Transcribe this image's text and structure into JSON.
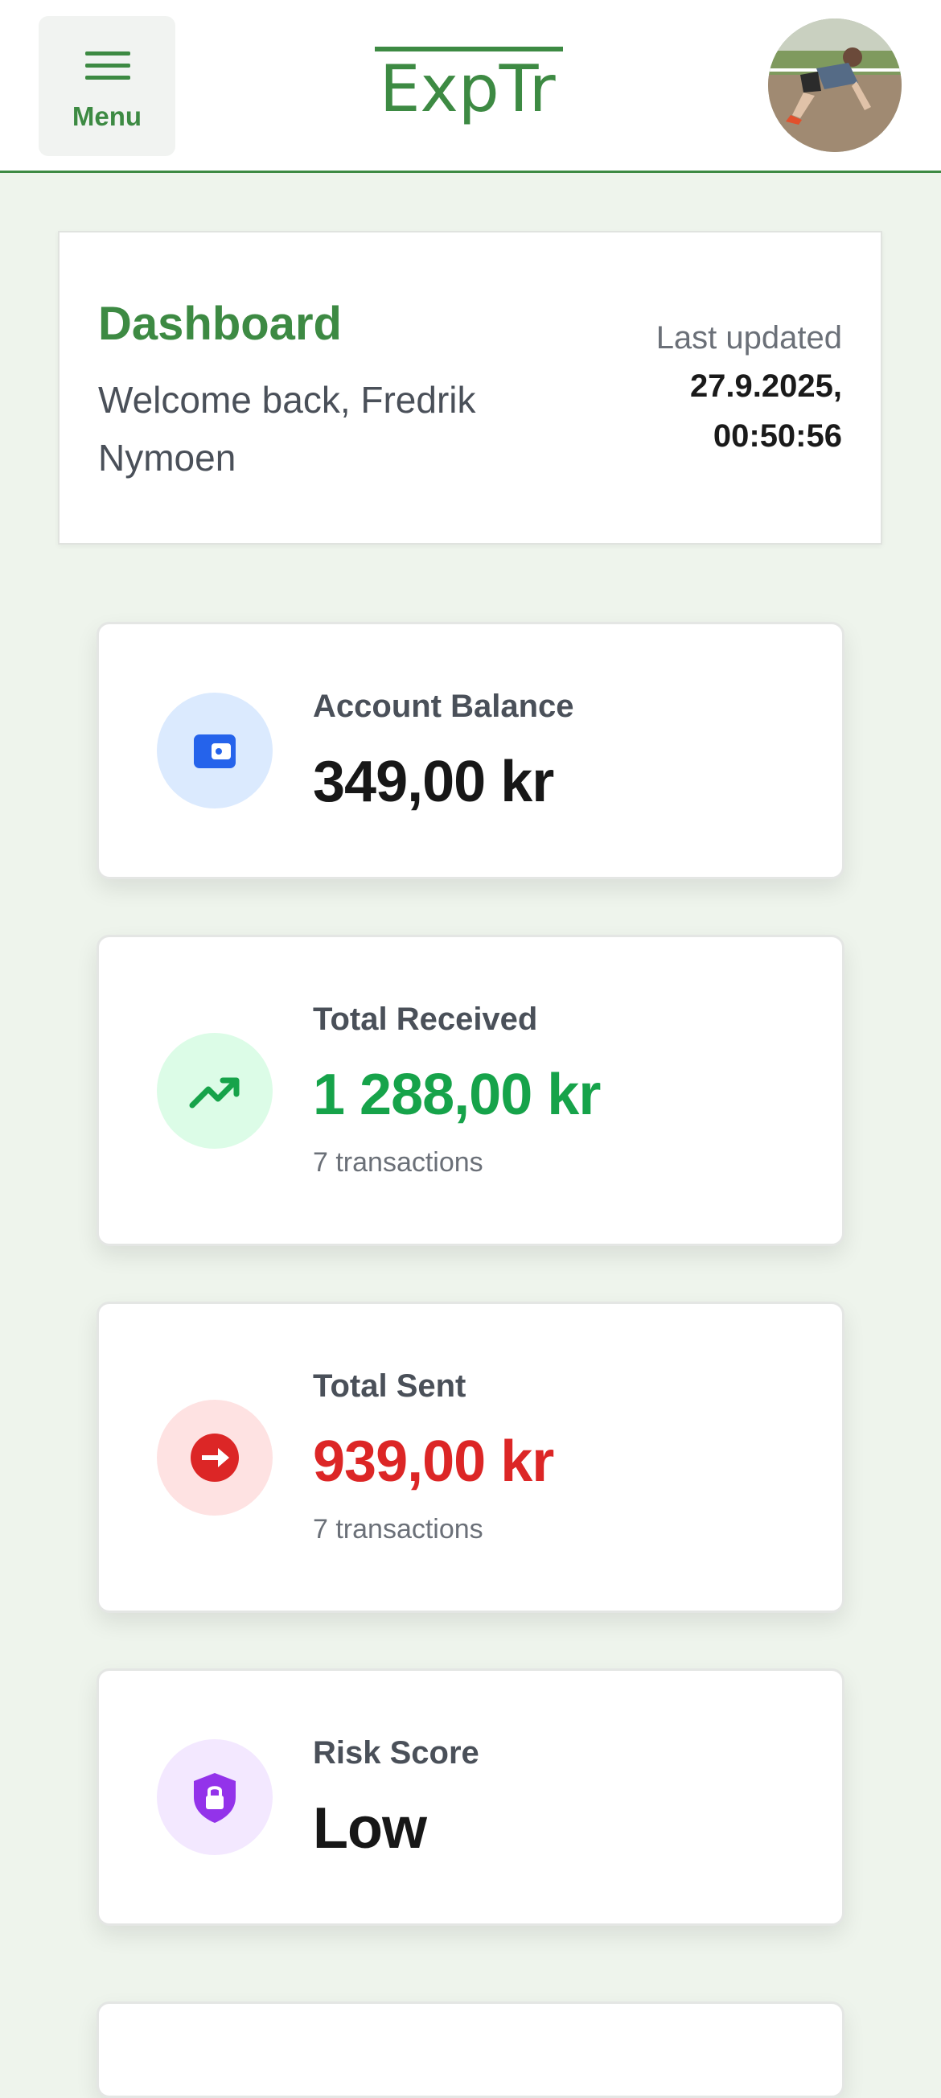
{
  "header": {
    "menu_label": "Menu",
    "logo_text": "ExpTr",
    "avatar_icon": "user-avatar-photo"
  },
  "dashboard": {
    "title": "Dashboard",
    "welcome": "Welcome back, Fredrik Nymoen",
    "last_updated_label": "Last updated",
    "last_updated_value": "27.9.2025, 00:50:56"
  },
  "stats": [
    {
      "label": "Account Balance",
      "value": "349,00 kr",
      "icon": "wallet-icon",
      "icon_bg": "#dbeafe",
      "icon_color": "#2563eb"
    },
    {
      "label": "Total Received",
      "value": "1 288,00 kr",
      "sub": "7 transactions",
      "icon": "trending-up-icon",
      "icon_bg": "#dcfce7",
      "icon_color": "#16a34a",
      "value_color": "#16a34a"
    },
    {
      "label": "Total Sent",
      "value": "939,00 kr",
      "sub": "7 transactions",
      "icon": "arrow-right-circle-icon",
      "icon_bg": "#fee2e2",
      "icon_color": "#dc2626",
      "value_color": "#dc2626"
    },
    {
      "label": "Risk Score",
      "value": "Low",
      "icon": "shield-lock-icon",
      "icon_bg": "#f3e8ff",
      "icon_color": "#9333ea"
    }
  ],
  "colors": {
    "brand": "#3d8a43",
    "background": "#eef4ec"
  }
}
